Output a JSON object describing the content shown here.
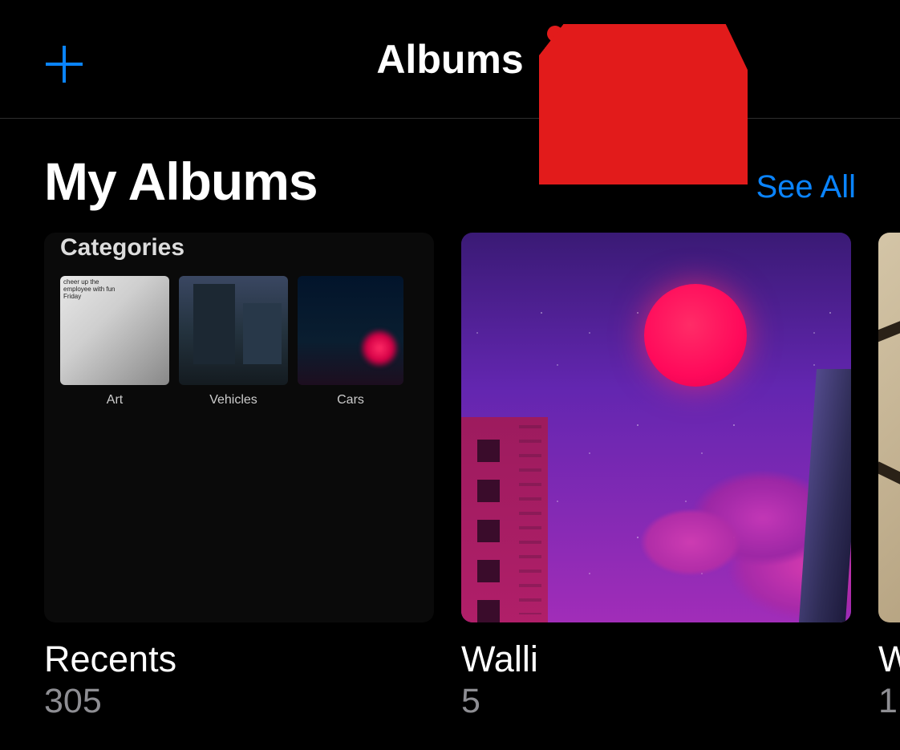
{
  "header": {
    "title": "Albums"
  },
  "section": {
    "title": "My Albums",
    "see_all": "See All"
  },
  "albums": [
    {
      "name": "Recents",
      "count": "305",
      "cover": {
        "categories_label": "Categories",
        "items": [
          {
            "label": "Art"
          },
          {
            "label": "Vehicles"
          },
          {
            "label": "Cars"
          }
        ]
      }
    },
    {
      "name": "Walli",
      "count": "5"
    },
    {
      "name": "W",
      "count": "1"
    }
  ],
  "annotation": {
    "target": "see-all"
  }
}
